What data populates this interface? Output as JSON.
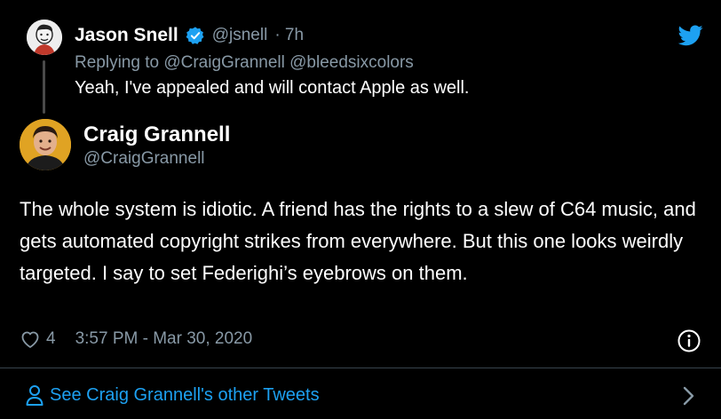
{
  "parent": {
    "name": "Jason Snell",
    "handle": "@jsnell",
    "time": "· 7h",
    "replying_prefix": "Replying to",
    "replying_to": "@CraigGrannell @bleedsixcolors",
    "text": "Yeah, I've appealed and will contact Apple as well."
  },
  "tweet": {
    "name": "Craig Grannell",
    "handle": "@CraigGrannell",
    "text": "The whole system is idiotic. A friend has the rights to a slew of C64 music, and gets automated copyright strikes from everywhere. But this one looks weirdly targeted. I say to set Federighi’s eyebrows on them.",
    "likes": "4",
    "timestamp": "3:57 PM - Mar 30, 2020"
  },
  "footer": {
    "see_more": "See Craig Grannell's other Tweets"
  },
  "colors": {
    "background": "#000000",
    "accent": "#1da1f2",
    "secondary_text": "#8899a6"
  },
  "icons": [
    "verified-badge-icon",
    "twitter-bird-icon",
    "heart-icon",
    "info-icon",
    "person-icon",
    "chevron-right-icon"
  ]
}
